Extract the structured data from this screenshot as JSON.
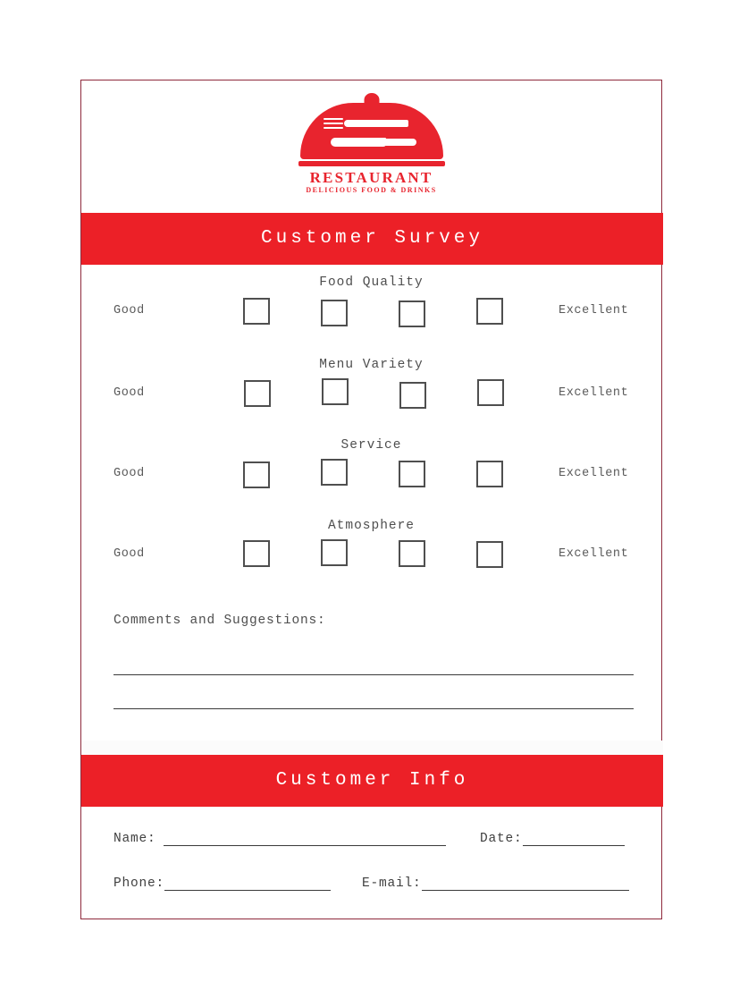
{
  "logo": {
    "icon": "cloche-dome-icon",
    "title": "RESTAURANT",
    "subtitle": "DELICIOUS FOOD & DRINKS",
    "color": "#e8242e"
  },
  "banners": {
    "survey_title": "Customer Survey",
    "info_title": "Customer Info",
    "background": "#ec2027",
    "text_color": "#ffffff"
  },
  "ratings": {
    "scale_low_label": "Good",
    "scale_high_label": "Excellent",
    "checkbox_count": 4,
    "blocks": [
      {
        "title": "Food Quality",
        "low": "Good",
        "high": "Excellent"
      },
      {
        "title": "Menu Variety",
        "low": "Good",
        "high": "Excellent"
      },
      {
        "title": "Service",
        "low": "Good",
        "high": "Excellent"
      },
      {
        "title": "Atmosphere",
        "low": "Good",
        "high": "Excellent"
      }
    ]
  },
  "comments": {
    "label": "Comments and Suggestions:",
    "line_count": 2
  },
  "customer_info": {
    "fields": [
      {
        "label": "Name:",
        "value": ""
      },
      {
        "label": "Date:",
        "value": ""
      },
      {
        "label": "Phone:",
        "value": ""
      },
      {
        "label": "E-mail:",
        "value": ""
      }
    ]
  },
  "page": {
    "border_color": "#8e2a3c",
    "text_color": "#4e4e4e",
    "checkbox_border": "#4f4f4f"
  }
}
